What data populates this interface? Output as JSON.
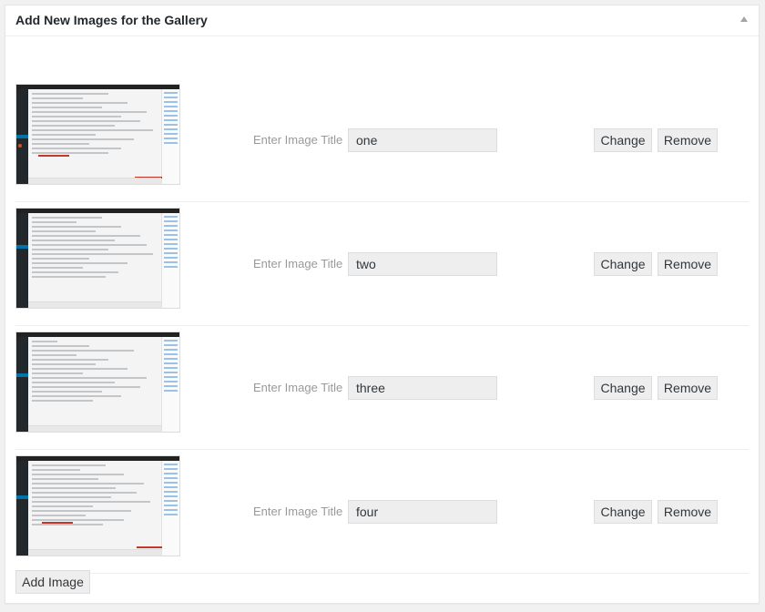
{
  "panel": {
    "title": "Add New Images for the Gallery"
  },
  "rows": [
    {
      "label": "Enter Image Title",
      "value": "one",
      "change": "Change",
      "remove": "Remove"
    },
    {
      "label": "Enter Image Title",
      "value": "two",
      "change": "Change",
      "remove": "Remove"
    },
    {
      "label": "Enter Image Title",
      "value": "three",
      "change": "Change",
      "remove": "Remove"
    },
    {
      "label": "Enter Image Title",
      "value": "four",
      "change": "Change",
      "remove": "Remove"
    }
  ],
  "add_button": "Add Image",
  "colors": {
    "button_bg": "#eeeeee",
    "border": "#dddddd",
    "label": "#999999"
  },
  "icons": {
    "toggle": "triangle-up-icon"
  }
}
